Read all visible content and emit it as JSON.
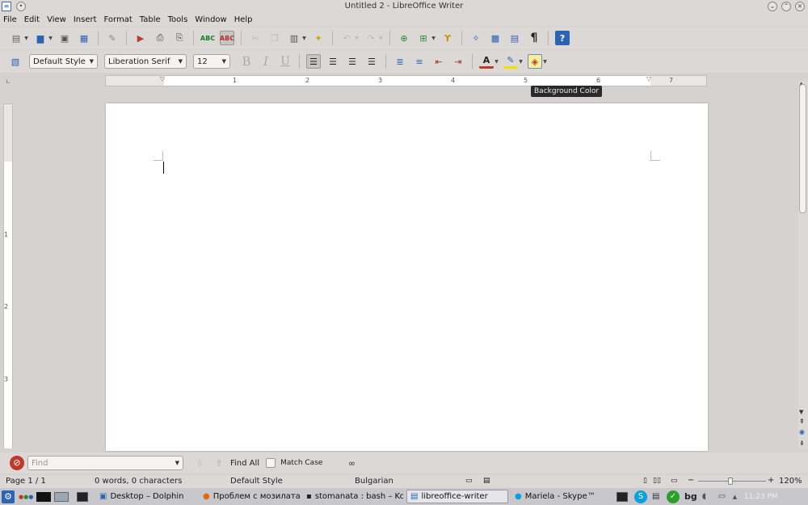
{
  "window": {
    "title": "Untitled 2 - LibreOffice Writer"
  },
  "menubar": {
    "items": [
      "File",
      "Edit",
      "View",
      "Insert",
      "Format",
      "Table",
      "Tools",
      "Window",
      "Help"
    ]
  },
  "formatting": {
    "style": "Default Style",
    "font": "Liberation Serif",
    "size": "12"
  },
  "ruler": {
    "h_numbers": [
      "1",
      "2",
      "3",
      "4",
      "5",
      "6",
      "7"
    ],
    "v_numbers": [
      "1",
      "2",
      "3"
    ]
  },
  "tooltip": {
    "text": "Background Color"
  },
  "findbar": {
    "placeholder": "Find",
    "find_all": "Find All",
    "match_case": "Match Case"
  },
  "status": {
    "page": "Page 1 / 1",
    "words": "0 words, 0 characters",
    "style": "Default Style",
    "language": "Bulgarian",
    "zoom": "120%"
  },
  "taskbar": {
    "tasks": [
      "Desktop – Dolphin",
      "Проблем с мозилата -",
      "stomanata : bash – Kons",
      "libreoffice-writer",
      "Mariela - Skype™"
    ],
    "keyboard": "bg",
    "clock": "11:23 PM"
  },
  "colors": {
    "accent": "#2b63b5",
    "window_bg": "#dcd8d5",
    "workspace": "#d6d2d0"
  }
}
